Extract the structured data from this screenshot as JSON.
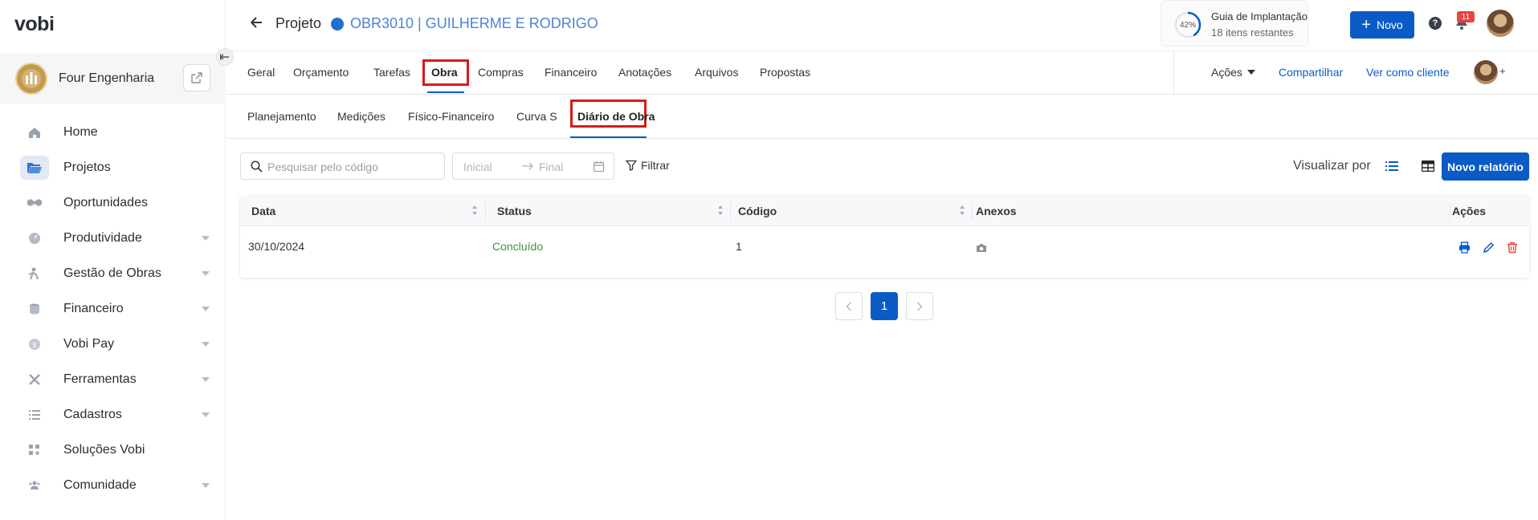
{
  "app": {
    "logo": "vobi"
  },
  "sidebar": {
    "org_name": "Four Engenharia",
    "items": [
      {
        "label": "Home",
        "icon": "home-icon",
        "active": false,
        "expandable": false
      },
      {
        "label": "Projetos",
        "icon": "folder-icon",
        "active": true,
        "expandable": false
      },
      {
        "label": "Oportunidades",
        "icon": "handshake-icon",
        "active": false,
        "expandable": false
      },
      {
        "label": "Produtividade",
        "icon": "gauge-icon",
        "active": false,
        "expandable": true
      },
      {
        "label": "Gestão de Obras",
        "icon": "worker-icon",
        "active": false,
        "expandable": true
      },
      {
        "label": "Financeiro",
        "icon": "coins-icon",
        "active": false,
        "expandable": true
      },
      {
        "label": "Vobi Pay",
        "icon": "dollar-icon",
        "active": false,
        "expandable": true
      },
      {
        "label": "Ferramentas",
        "icon": "tools-icon",
        "active": false,
        "expandable": true
      },
      {
        "label": "Cadastros",
        "icon": "list-icon",
        "active": false,
        "expandable": true
      },
      {
        "label": "Soluções Vobi",
        "icon": "grid-plus-icon",
        "active": false,
        "expandable": false
      },
      {
        "label": "Comunidade",
        "icon": "people-icon",
        "active": false,
        "expandable": true
      }
    ]
  },
  "header": {
    "project_label": "Projeto",
    "project_name": "OBR3010 | GUILHERME E RODRIGO",
    "guide": {
      "percent": "42%",
      "percent_value": 42,
      "title": "Guia de Implantação",
      "subtitle": "18 itens restantes"
    },
    "new_button": "Novo",
    "help": "?",
    "notifications": "11"
  },
  "tabs": {
    "items": [
      "Geral",
      "Orçamento",
      "Tarefas",
      "Obra",
      "Compras",
      "Financeiro",
      "Anotações",
      "Arquivos",
      "Propostas"
    ],
    "active": "Obra",
    "actions": "Ações",
    "share": "Compartilhar",
    "view_as_client": "Ver como cliente",
    "plus": "+"
  },
  "subtabs": {
    "items": [
      "Planejamento",
      "Medições",
      "Físico-Financeiro",
      "Curva S",
      "Diário de Obra"
    ],
    "active": "Diário de Obra"
  },
  "toolbar": {
    "search_placeholder": "Pesquisar pelo código",
    "date_start_placeholder": "Inicial",
    "date_end_placeholder": "Final",
    "filter": "Filtrar",
    "view_by": "Visualizar por",
    "new_report": "Novo relatório"
  },
  "table": {
    "columns": [
      "Data",
      "Status",
      "Código",
      "Anexos",
      "Ações"
    ],
    "rows": [
      {
        "date": "30/10/2024",
        "status": "Concluído",
        "code": "1"
      }
    ]
  },
  "pagination": {
    "current": "1"
  },
  "colors": {
    "primary": "#0a5bc6",
    "highlight": "#d91a1a",
    "status_done": "#3a9a3a",
    "delete": "#e8433f"
  }
}
